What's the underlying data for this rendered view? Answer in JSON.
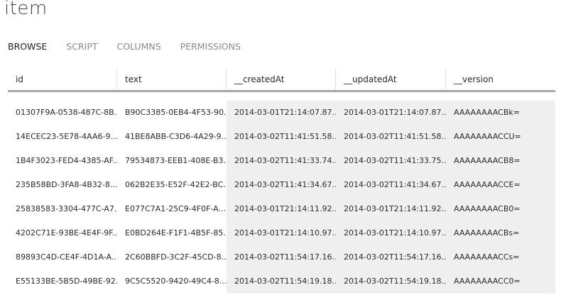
{
  "page_title": "item",
  "tabs": [
    {
      "label": "BROWSE",
      "active": true
    },
    {
      "label": "SCRIPT",
      "active": false
    },
    {
      "label": "COLUMNS",
      "active": false
    },
    {
      "label": "PERMISSIONS",
      "active": false
    }
  ],
  "table": {
    "columns": [
      "id",
      "text",
      "__createdAt",
      "__updatedAt",
      "__version"
    ],
    "rows": [
      [
        "01307F9A-0538-487C-8B...",
        "B90C3385-0EB4-4F53-90...",
        "2014-03-01T21:14:07.87...",
        "2014-03-01T21:14:07.87...",
        "AAAAAAAACBk="
      ],
      [
        "14ECEC23-5E78-4AA6-9...",
        "41BE8ABB-C3D6-4A29-9...",
        "2014-03-02T11:41:51.58...",
        "2014-03-02T11:41:51.58...",
        "AAAAAAAACCU="
      ],
      [
        "1B4F3023-FED4-4385-AF...",
        "79534873-EEB1-408E-B3...",
        "2014-03-02T11:41:33.74...",
        "2014-03-02T11:41:33.75...",
        "AAAAAAAACB8="
      ],
      [
        "235B58BD-3FA8-4B32-8...",
        "062B2E35-E52F-42E2-BC...",
        "2014-03-02T11:41:34.67...",
        "2014-03-02T11:41:34.67...",
        "AAAAAAAACCE="
      ],
      [
        "25838583-3304-477C-A7...",
        "E077C7A1-25C9-4F0F-A...",
        "2014-03-01T21:14:11.92...",
        "2014-03-01T21:14:11.92...",
        "AAAAAAAACB0="
      ],
      [
        "4202C71E-93BE-4E4F-9F...",
        "E0BD264E-F1F1-4B5F-85...",
        "2014-03-01T21:14:10.97...",
        "2014-03-01T21:14:10.97...",
        "AAAAAAAACBs="
      ],
      [
        "89893C4D-CE4F-4D1A-A...",
        "2C60BBFD-3C2F-45CD-8...",
        "2014-03-02T11:54:17.16...",
        "2014-03-02T11:54:17.16...",
        "AAAAAAAACCs="
      ],
      [
        "E55133BE-5B5D-49BE-92...",
        "9C5C5520-9420-49C4-8...",
        "2014-03-02T11:54:19.18...",
        "2014-03-02T11:54:19.18...",
        "AAAAAAAACC0="
      ]
    ]
  }
}
